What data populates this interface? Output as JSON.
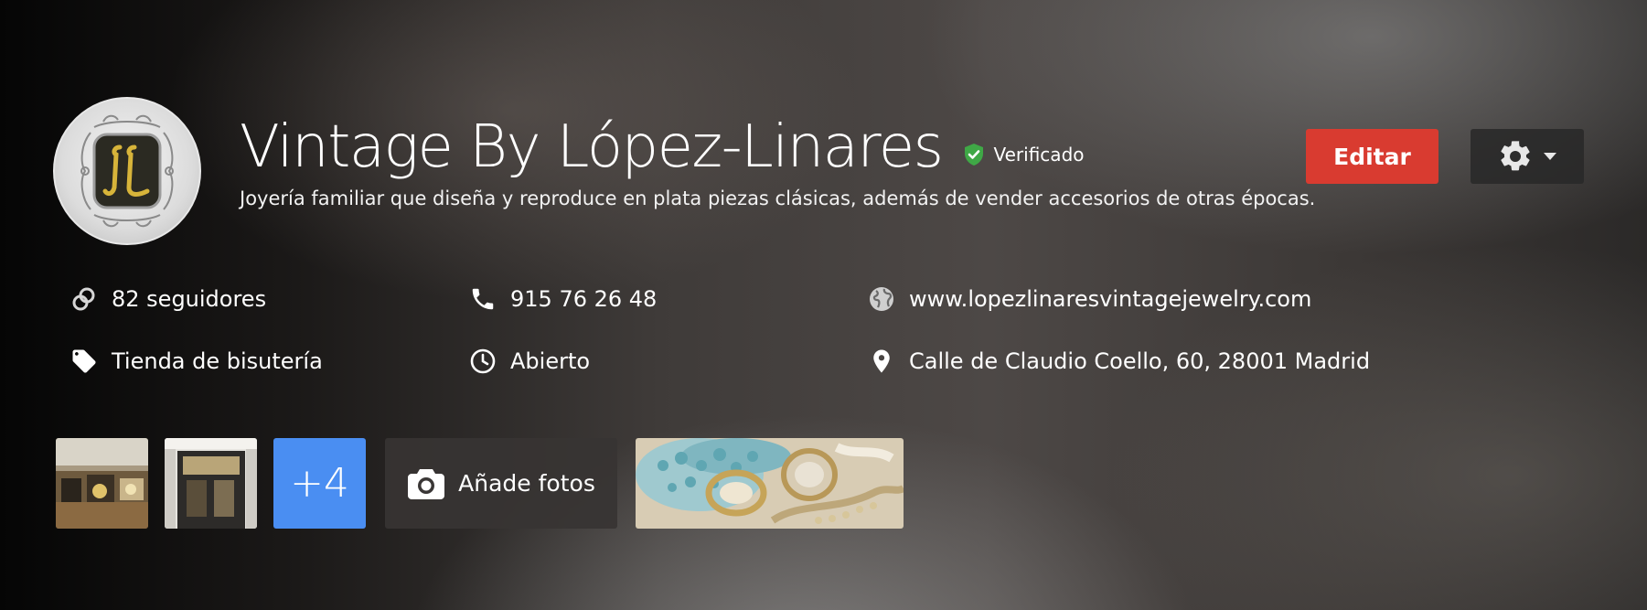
{
  "business": {
    "name": "Vintage By López-Linares",
    "verified_label": "Verificado",
    "description": "Joyería familiar que diseña y reproduce en plata piezas clásicas, además de vender accesorios de otras épocas.",
    "avatar_icon": "monogram-logo"
  },
  "actions": {
    "edit_label": "Editar",
    "settings_icon": "gear-icon"
  },
  "info": {
    "followers": {
      "icon": "circles-icon",
      "text": "82 seguidores"
    },
    "phone": {
      "icon": "phone-icon",
      "text": "915 76 26 48"
    },
    "website": {
      "icon": "globe-icon",
      "text": "www.lopezlinaresvintagejewelry.com"
    },
    "category": {
      "icon": "tag-icon",
      "text": "Tienda de bisutería"
    },
    "hours": {
      "icon": "clock-icon",
      "text": "Abierto"
    },
    "address": {
      "icon": "location-pin-icon",
      "text": "Calle de Claudio Coello, 60, 28001 Madrid"
    }
  },
  "photos": {
    "more_label": "+4",
    "add_label": "Añade fotos",
    "add_icon": "camera-icon"
  },
  "colors": {
    "edit_button": "#d93b30",
    "more_button": "#4a8ef2",
    "verified_badge": "#3fa846"
  }
}
